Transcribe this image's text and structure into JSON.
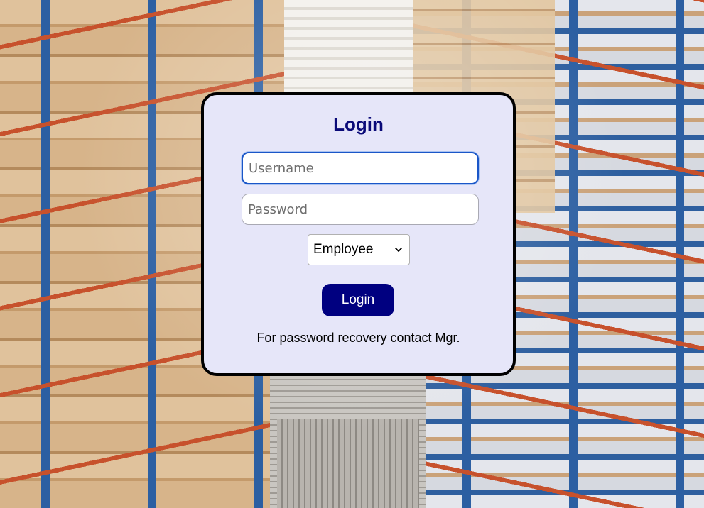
{
  "login": {
    "title": "Login",
    "username_placeholder": "Username",
    "password_placeholder": "Password",
    "role_selected": "Employee",
    "login_button": "Login",
    "recovery_note": "For password recovery contact Mgr."
  },
  "colors": {
    "card_background": "#e6e6f9",
    "title_color": "#0a0a78",
    "button_background": "#000080",
    "focus_border": "#1a56c8"
  },
  "icons": {
    "select_arrow": "chevron-down-icon"
  }
}
